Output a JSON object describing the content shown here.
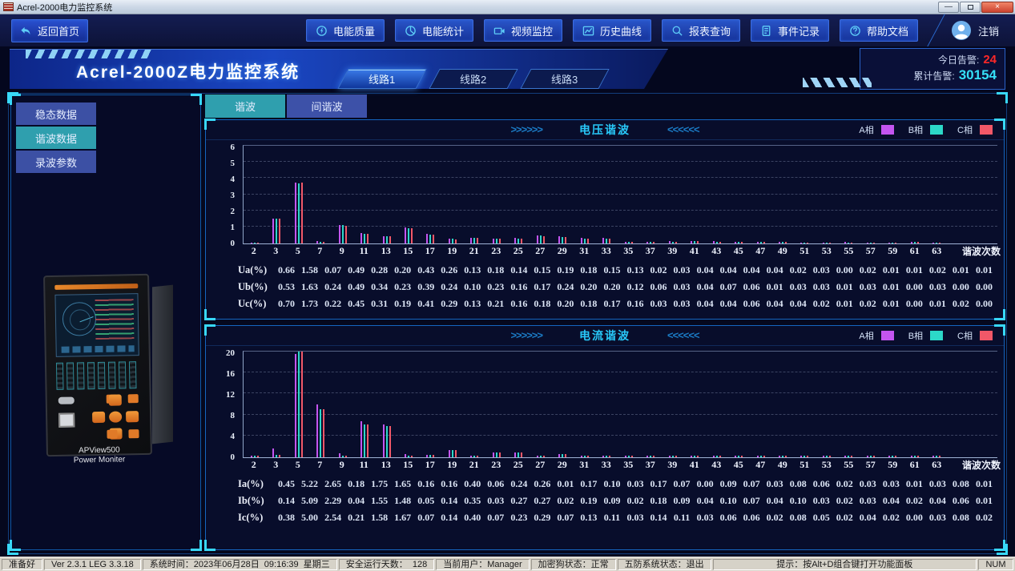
{
  "window": {
    "title": "Acrel-2000电力监控系统"
  },
  "nav": {
    "home": {
      "label": "返回首页"
    },
    "buttons": [
      {
        "label": "电能质量",
        "icon": "power-quality-icon"
      },
      {
        "label": "电能统计",
        "icon": "energy-statistics-icon"
      },
      {
        "label": "视频监控",
        "icon": "video-monitor-icon"
      },
      {
        "label": "历史曲线",
        "icon": "history-curve-icon"
      },
      {
        "label": "报表查询",
        "icon": "report-query-icon"
      },
      {
        "label": "事件记录",
        "icon": "event-record-icon"
      },
      {
        "label": "帮助文档",
        "icon": "help-doc-icon"
      }
    ],
    "logout": {
      "label": "注销"
    }
  },
  "header": {
    "system_title": "Acrel-2000Z电力监控系统",
    "line_tabs": [
      {
        "label": "线路1",
        "active": true
      },
      {
        "label": "线路2",
        "active": false
      },
      {
        "label": "线路3",
        "active": false
      }
    ],
    "alarm": {
      "today_label": "今日告警:",
      "today_value": "24",
      "total_label": "累计告警:",
      "total_value": "30154"
    }
  },
  "sidebar": {
    "items": [
      {
        "label": "稳态数据",
        "active": false
      },
      {
        "label": "谐波数据",
        "active": true
      },
      {
        "label": "录波参数",
        "active": false
      }
    ],
    "device": {
      "line1": "APView500",
      "line2": "Power Moniter"
    }
  },
  "main": {
    "tabs": [
      {
        "label": "谐波",
        "active": true
      },
      {
        "label": "间谐波",
        "active": false
      }
    ]
  },
  "chart_data": [
    {
      "type": "bar",
      "title": "电压谐波",
      "xlabel": "谐波次数",
      "ylim": [
        0,
        6
      ],
      "yticks": [
        0,
        1,
        2,
        3,
        4,
        5,
        6
      ],
      "grid": true,
      "legend_position": "top-right",
      "categories": [
        2,
        3,
        5,
        7,
        9,
        11,
        13,
        15,
        17,
        19,
        21,
        23,
        25,
        27,
        29,
        31,
        33,
        35,
        37,
        39,
        41,
        43,
        45,
        47,
        49,
        51,
        53,
        55,
        57,
        59,
        61,
        63
      ],
      "series": [
        {
          "name": "A相",
          "color": "#c455f0",
          "values": [
            0.05,
            1.5,
            3.7,
            0.12,
            1.1,
            0.6,
            0.42,
            0.95,
            0.55,
            0.25,
            0.3,
            0.27,
            0.3,
            0.45,
            0.4,
            0.3,
            0.3,
            0.08,
            0.1,
            0.12,
            0.12,
            0.12,
            0.1,
            0.06,
            0.08,
            0.04,
            0.05,
            0.06,
            0.04,
            0.05,
            0.08,
            0.04
          ]
        },
        {
          "name": "B相",
          "color": "#2cd8c8",
          "values": [
            0.05,
            1.5,
            3.65,
            0.1,
            1.1,
            0.58,
            0.42,
            0.92,
            0.52,
            0.25,
            0.3,
            0.27,
            0.28,
            0.45,
            0.38,
            0.28,
            0.28,
            0.07,
            0.1,
            0.1,
            0.12,
            0.1,
            0.08,
            0.06,
            0.08,
            0.04,
            0.05,
            0.05,
            0.04,
            0.05,
            0.07,
            0.04
          ]
        },
        {
          "name": "C相",
          "color": "#f25868",
          "values": [
            0.05,
            1.5,
            3.7,
            0.1,
            1.08,
            0.58,
            0.4,
            0.92,
            0.52,
            0.24,
            0.3,
            0.26,
            0.28,
            0.44,
            0.38,
            0.28,
            0.28,
            0.07,
            0.09,
            0.1,
            0.11,
            0.1,
            0.08,
            0.06,
            0.07,
            0.04,
            0.05,
            0.05,
            0.04,
            0.04,
            0.07,
            0.04
          ]
        }
      ],
      "table": {
        "rows": [
          {
            "label": "Ua(%)",
            "values": [
              0.66,
              1.58,
              0.07,
              0.49,
              0.28,
              0.2,
              0.43,
              0.26,
              0.13,
              0.18,
              0.14,
              0.15,
              0.19,
              0.18,
              0.15,
              0.13,
              0.02,
              0.03,
              0.04,
              0.04,
              0.04,
              0.04,
              0.02,
              0.03,
              0.0,
              0.02,
              0.01,
              0.01,
              0.02,
              0.01,
              0.01
            ]
          },
          {
            "label": "Ub(%)",
            "values": [
              0.53,
              1.63,
              0.24,
              0.49,
              0.34,
              0.23,
              0.39,
              0.24,
              0.1,
              0.23,
              0.16,
              0.17,
              0.24,
              0.2,
              0.2,
              0.12,
              0.06,
              0.03,
              0.04,
              0.07,
              0.06,
              0.01,
              0.03,
              0.03,
              0.01,
              0.03,
              0.01,
              0.0,
              0.03,
              0.0,
              0.0
            ]
          },
          {
            "label": "Uc(%)",
            "values": [
              0.7,
              1.73,
              0.22,
              0.45,
              0.31,
              0.19,
              0.41,
              0.29,
              0.13,
              0.21,
              0.16,
              0.18,
              0.2,
              0.18,
              0.17,
              0.16,
              0.03,
              0.03,
              0.04,
              0.04,
              0.06,
              0.04,
              0.04,
              0.02,
              0.01,
              0.02,
              0.01,
              0.0,
              0.01,
              0.02,
              0.0
            ]
          }
        ]
      }
    },
    {
      "type": "bar",
      "title": "电流谐波",
      "xlabel": "谐波次数",
      "ylim": [
        0,
        20
      ],
      "yticks": [
        0,
        4,
        8,
        12,
        16,
        20
      ],
      "grid": true,
      "legend_position": "top-right",
      "categories": [
        2,
        3,
        5,
        7,
        9,
        11,
        13,
        15,
        17,
        19,
        21,
        23,
        25,
        27,
        29,
        31,
        33,
        35,
        37,
        39,
        41,
        43,
        45,
        47,
        49,
        51,
        53,
        55,
        57,
        59,
        61,
        63
      ],
      "series": [
        {
          "name": "A相",
          "color": "#c455f0",
          "values": [
            0.2,
            1.6,
            19.5,
            10.0,
            0.7,
            6.7,
            6.2,
            0.6,
            0.45,
            1.3,
            0.15,
            0.9,
            0.9,
            0.1,
            0.55,
            0.3,
            0.25,
            0.1,
            0.15,
            0.1,
            0.1,
            0.1,
            0.1,
            0.05,
            0.1,
            0.05,
            0.05,
            0.05,
            0.05,
            0.05,
            0.1,
            0.05
          ]
        },
        {
          "name": "B相",
          "color": "#2cd8c8",
          "values": [
            0.15,
            0.4,
            20.0,
            9.0,
            0.1,
            6.1,
            5.8,
            0.1,
            0.45,
            1.25,
            0.1,
            0.85,
            0.85,
            0.1,
            0.5,
            0.28,
            0.2,
            0.08,
            0.12,
            0.1,
            0.1,
            0.1,
            0.08,
            0.05,
            0.08,
            0.05,
            0.05,
            0.05,
            0.04,
            0.05,
            0.08,
            0.05
          ]
        },
        {
          "name": "C相",
          "color": "#f25868",
          "values": [
            0.15,
            0.4,
            20.0,
            9.0,
            0.1,
            6.1,
            5.8,
            0.1,
            0.4,
            1.25,
            0.1,
            0.85,
            0.85,
            0.1,
            0.5,
            0.28,
            0.2,
            0.08,
            0.12,
            0.1,
            0.1,
            0.1,
            0.08,
            0.05,
            0.08,
            0.05,
            0.05,
            0.05,
            0.04,
            0.05,
            0.08,
            0.05
          ]
        }
      ],
      "table": {
        "rows": [
          {
            "label": "Ia(%)",
            "values": [
              0.45,
              5.22,
              2.65,
              0.18,
              1.75,
              1.65,
              0.16,
              0.16,
              0.4,
              0.06,
              0.24,
              0.26,
              0.01,
              0.17,
              0.1,
              0.03,
              0.17,
              0.07,
              0.0,
              0.09,
              0.07,
              0.03,
              0.08,
              0.06,
              0.02,
              0.03,
              0.03,
              0.01,
              0.03,
              0.08,
              0.01
            ]
          },
          {
            "label": "Ib(%)",
            "values": [
              0.14,
              5.09,
              2.29,
              0.04,
              1.55,
              1.48,
              0.05,
              0.14,
              0.35,
              0.03,
              0.27,
              0.27,
              0.02,
              0.19,
              0.09,
              0.02,
              0.18,
              0.09,
              0.04,
              0.1,
              0.07,
              0.04,
              0.1,
              0.03,
              0.02,
              0.03,
              0.04,
              0.02,
              0.04,
              0.06,
              0.01
            ]
          },
          {
            "label": "Ic(%)",
            "values": [
              0.38,
              5.0,
              2.54,
              0.21,
              1.58,
              1.67,
              0.07,
              0.14,
              0.4,
              0.07,
              0.23,
              0.29,
              0.07,
              0.13,
              0.11,
              0.03,
              0.14,
              0.11,
              0.03,
              0.06,
              0.06,
              0.02,
              0.08,
              0.05,
              0.02,
              0.04,
              0.02,
              0.0,
              0.03,
              0.08,
              0.02
            ]
          }
        ]
      }
    }
  ],
  "statusbar": {
    "segments": [
      "准备好",
      "Ver 2.3.1 LEG 3.3.18",
      "系统时间：2023年06月28日  09:16:39  星期三",
      "安全运行天数：  128",
      "当前用户：Manager",
      "加密狗状态：正常",
      "五防系统状态：退出"
    ],
    "hint": "提示：按Alt+D组合键打开功能面板",
    "num": "NUM"
  }
}
